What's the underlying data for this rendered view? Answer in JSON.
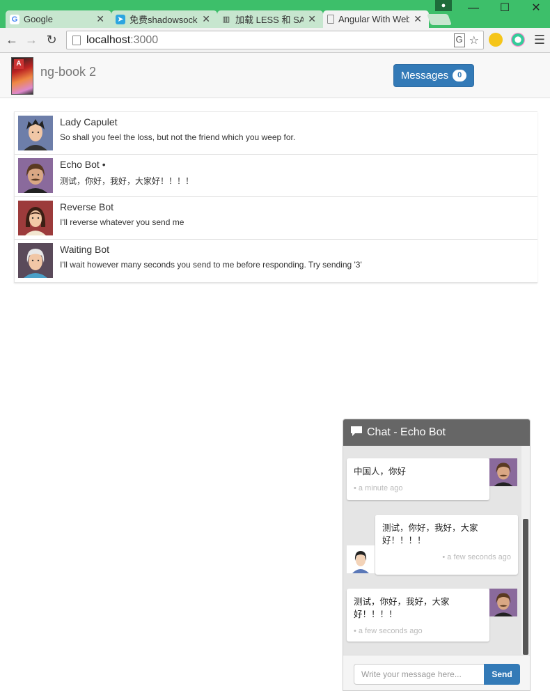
{
  "browser": {
    "tabs": [
      {
        "title": "Google",
        "icon": "google-icon",
        "active": false
      },
      {
        "title": "免费shadowsocks",
        "icon": "telegram-icon",
        "active": false
      },
      {
        "title": "加载 LESS 和 SASS",
        "icon": "book-icon",
        "active": false
      },
      {
        "title": "Angular With Web",
        "icon": "page-icon",
        "active": true
      }
    ],
    "url_host": "localhost",
    "url_port": ":3000"
  },
  "navbar": {
    "brand": "ng-book 2",
    "messages_label": "Messages",
    "messages_count": "0"
  },
  "threads": [
    {
      "name": "Lady Capulet",
      "preview": "So shall you feel the loss, but not the friend which you weep for."
    },
    {
      "name": "Echo Bot •",
      "preview": "测试，你好，我好，大家好！！！！"
    },
    {
      "name": "Reverse Bot",
      "preview": "I'll reverse whatever you send me"
    },
    {
      "name": "Waiting Bot",
      "preview": "I'll wait however many seconds you send to me before responding. Try sending '3'"
    }
  ],
  "chat": {
    "title": "Chat - Echo Bot",
    "messages": [
      {
        "text": "中国人，你好",
        "time": "• a minute ago"
      },
      {
        "text": "测试，你好，我好，大家好！！！！",
        "time": "• a few seconds ago"
      },
      {
        "text": "测试，你好，我好，大家好！！！！",
        "time": "• a few seconds ago"
      }
    ],
    "input_placeholder": "Write your message here...",
    "send_label": "Send"
  },
  "colors": {
    "chrome_frame": "#3dbf6a",
    "primary_button": "#337ab7",
    "chat_header": "#666666"
  }
}
